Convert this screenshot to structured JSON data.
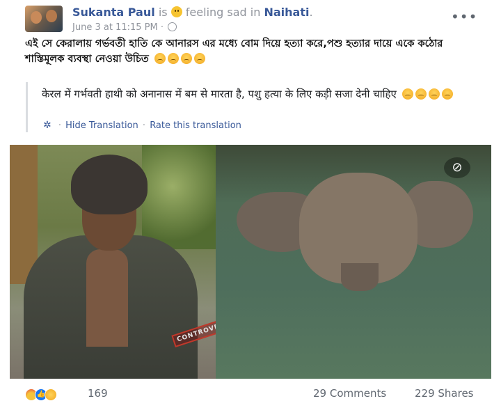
{
  "post": {
    "author": "Sukanta Paul",
    "is_text": "is",
    "feeling_text": "feeling sad in",
    "location": "Naihati",
    "location_suffix": ".",
    "timestamp": "June 3 at 11:15 PM",
    "meta_sep": "·",
    "more_label": "•••",
    "body_text": "এই সে কেরালায় গর্ভবতী হাতি কে আনারস এর মধ্যে বোম দিয়ে হত্যা করে,পশু হত্যার দায়ে একে কঠোর শাস্তিমূলক ব্যবস্থা নেওয়া উচিত",
    "translation": "केरल में गर्भवती हाथी को अनानास में बम से मारता है, पशु हत्या के लिए कड़ी सजा देनी चाहिए",
    "hide_translation": "Hide Translation",
    "link_sep": "·",
    "rate_translation": "Rate this translation",
    "watermark": "CONTROVERSY BOY",
    "hide_eye_icon": "eye-slash-icon"
  },
  "footer": {
    "reaction_count": "169",
    "comments": "29 Comments",
    "shares": "229 Shares"
  },
  "colors": {
    "link": "#385898",
    "meta": "#90949c",
    "like_blue": "#1877f2"
  }
}
